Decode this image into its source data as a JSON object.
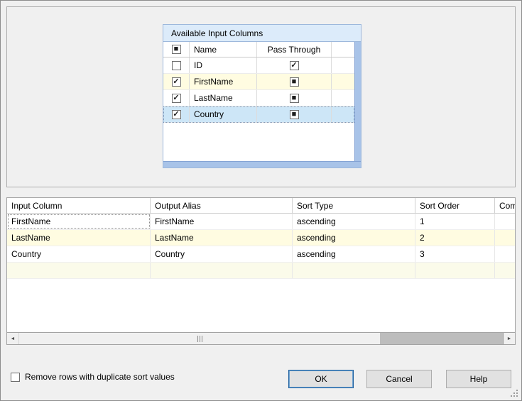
{
  "colors": {
    "selection_blue": "#cde6f7",
    "row_yellow": "#fffce1",
    "new_row_yellow": "#fbfbea",
    "panel_title_blue": "#dcebfa",
    "scrollbar_blue": "#a8c3e8",
    "ok_focus_border": "#1d5f9e"
  },
  "available_columns": {
    "title": "Available Input Columns",
    "select_all_glyph": "■",
    "headers": {
      "name": "Name",
      "pass_through": "Pass Through"
    },
    "rows": [
      {
        "name": "ID",
        "check_glyph": "",
        "pass_glyph": "✓"
      },
      {
        "name": "FirstName",
        "check_glyph": "✓",
        "pass_glyph": "■"
      },
      {
        "name": "LastName",
        "check_glyph": "✓",
        "pass_glyph": "■"
      },
      {
        "name": "Country",
        "check_glyph": "✓",
        "pass_glyph": "■"
      }
    ]
  },
  "sort_grid": {
    "headers": [
      "Input Column",
      "Output Alias",
      "Sort Type",
      "Sort Order",
      "Compa"
    ],
    "rows": [
      {
        "input_column": "FirstName",
        "output_alias": "FirstName",
        "sort_type": "ascending",
        "sort_order": "1",
        "comparison": ""
      },
      {
        "input_column": "LastName",
        "output_alias": "LastName",
        "sort_type": "ascending",
        "sort_order": "2",
        "comparison": ""
      },
      {
        "input_column": "Country",
        "output_alias": "Country",
        "sort_type": "ascending",
        "sort_order": "3",
        "comparison": ""
      },
      {
        "input_column": "",
        "output_alias": "",
        "sort_type": "",
        "sort_order": "",
        "comparison": ""
      }
    ]
  },
  "scrollbar": {
    "left_arrow": "◄",
    "right_arrow": "►"
  },
  "footer": {
    "duplicate_label": "Remove rows with duplicate sort values",
    "duplicate_check_glyph": "",
    "ok": "OK",
    "cancel": "Cancel",
    "help": "Help"
  }
}
